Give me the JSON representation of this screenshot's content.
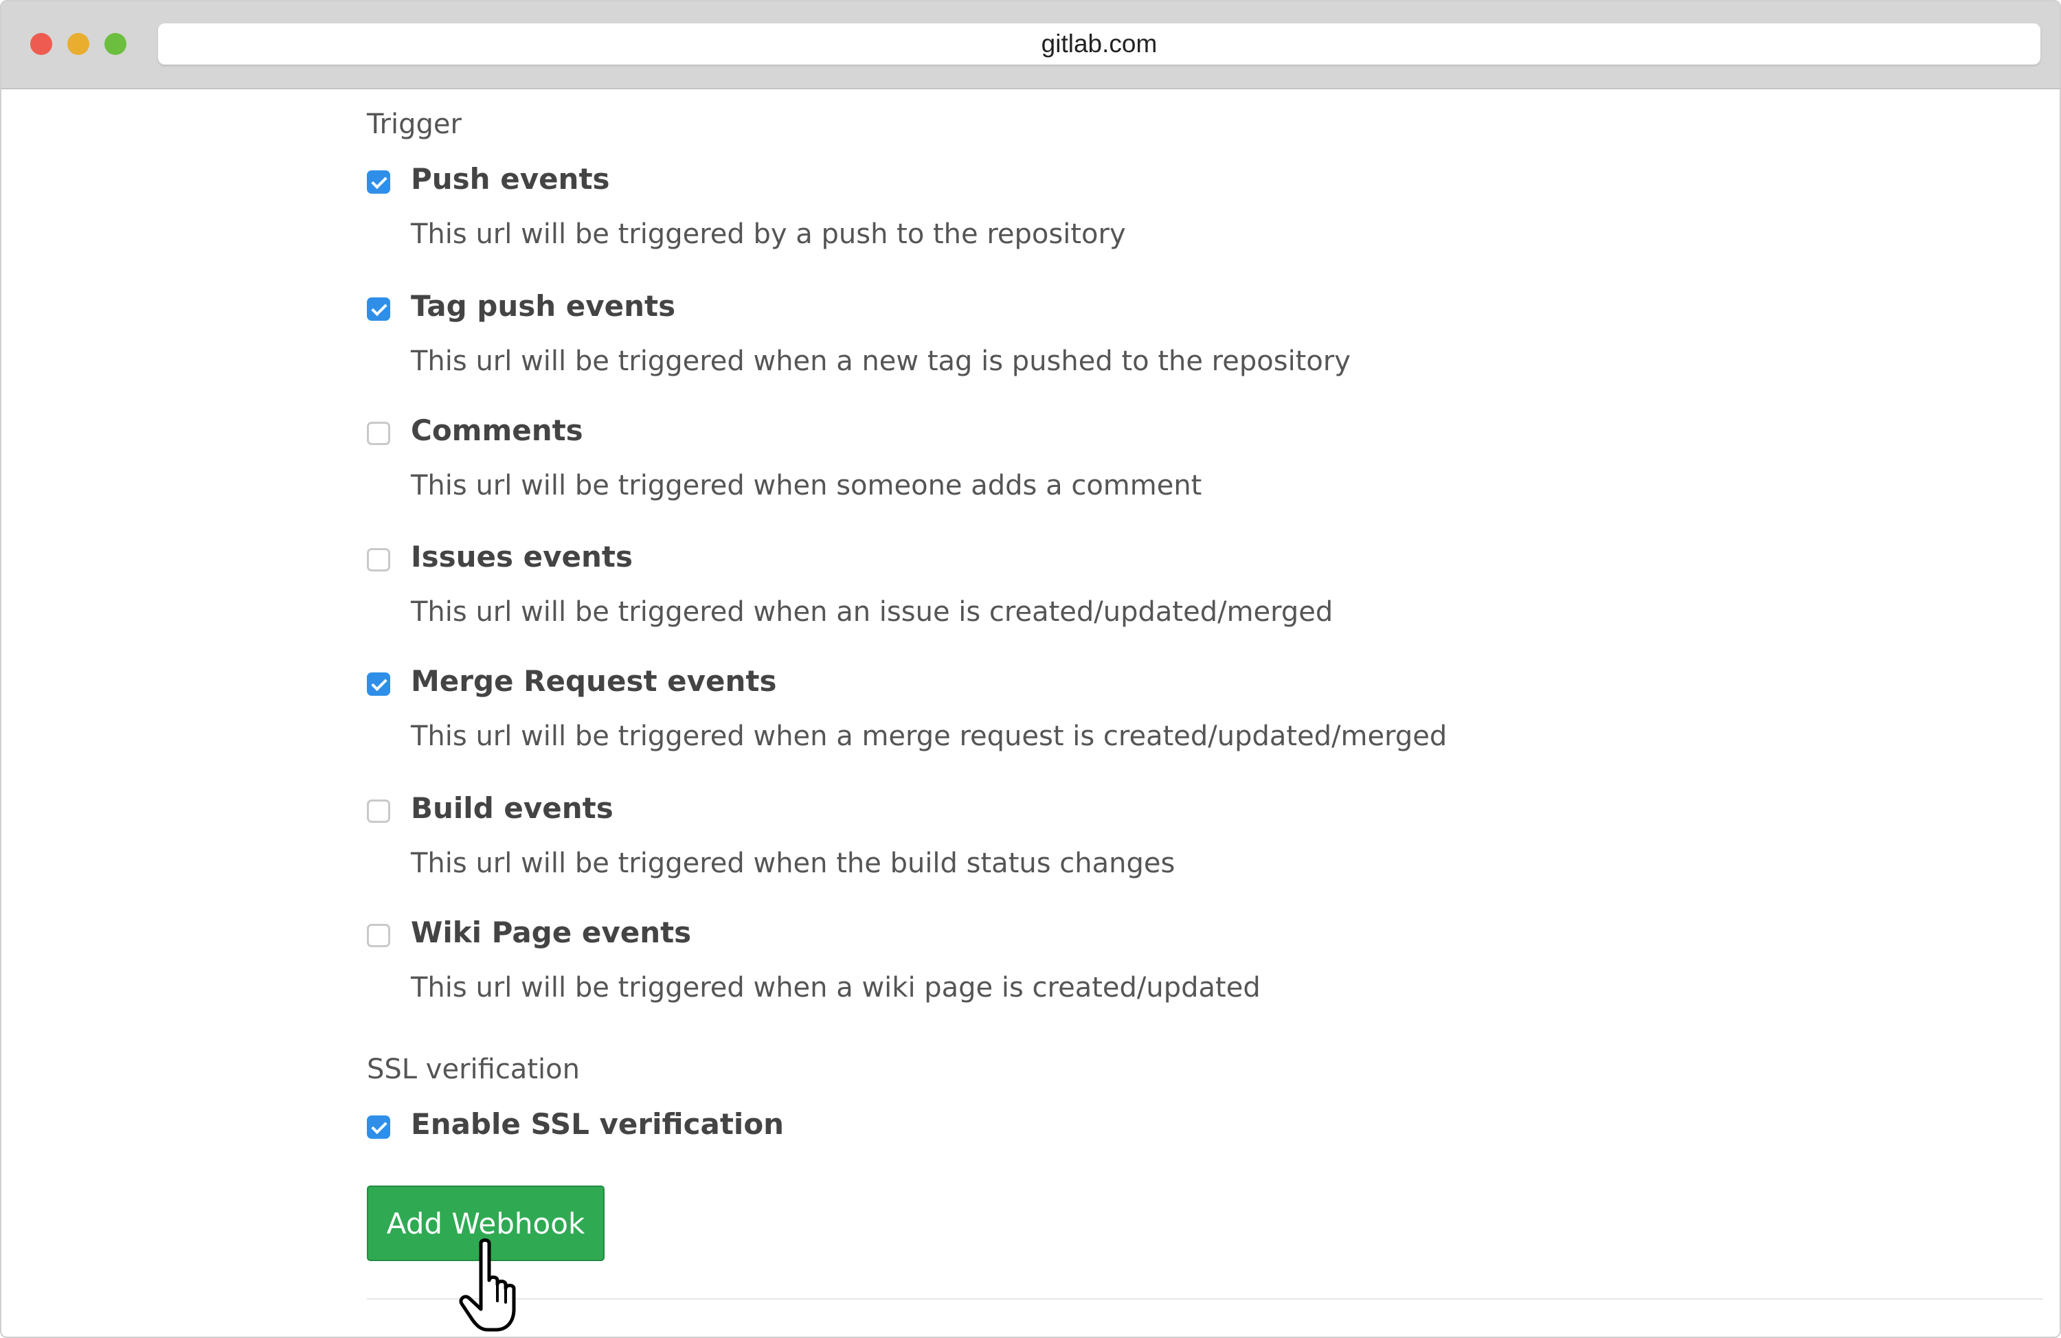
{
  "browser": {
    "url": "gitlab.com"
  },
  "trigger": {
    "label": "Trigger",
    "options": [
      {
        "title": "Push events",
        "description": "This url will be triggered by a push to the repository",
        "checked": true
      },
      {
        "title": "Tag push events",
        "description": "This url will be triggered when a new tag is pushed to the repository",
        "checked": true
      },
      {
        "title": "Comments",
        "description": "This url will be triggered when someone adds a comment",
        "checked": false
      },
      {
        "title": "Issues events",
        "description": "This url will be triggered when an issue is created/updated/merged",
        "checked": false
      },
      {
        "title": "Merge Request events",
        "description": "This url will be triggered when a merge request is created/updated/merged",
        "checked": true
      },
      {
        "title": "Build events",
        "description": "This url will be triggered when the build status changes",
        "checked": false
      },
      {
        "title": "Wiki Page events",
        "description": "This url will be triggered when a wiki page is created/updated",
        "checked": false
      }
    ]
  },
  "ssl": {
    "label": "SSL verification",
    "option": {
      "title": "Enable SSL verification",
      "checked": true
    }
  },
  "actions": {
    "add_webhook_label": "Add Webhook"
  },
  "colors": {
    "checkbox_checked": "#2f8fe8",
    "button_green": "#2faa53"
  }
}
